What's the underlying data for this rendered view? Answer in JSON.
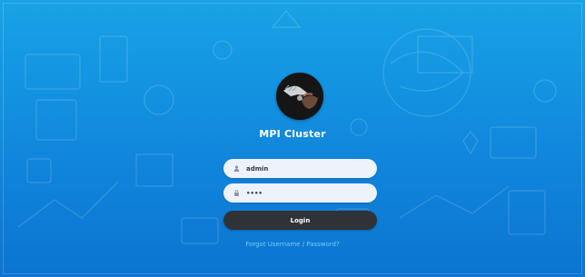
{
  "app": {
    "title": "MPI Cluster"
  },
  "login_form": {
    "username_value": "admin",
    "password_value": "••••",
    "login_button_label": "Login",
    "forgot_link_text": "Forgot Username / Password?"
  },
  "icons": {
    "username_field_icon": "user-icon",
    "password_field_icon": "lock-icon"
  },
  "colors": {
    "background_top": "#18a3e6",
    "background_bottom": "#0c74d1",
    "field_background": "#eef2fb",
    "button_background": "#2f3338",
    "link_color": "#7fc8f2"
  }
}
